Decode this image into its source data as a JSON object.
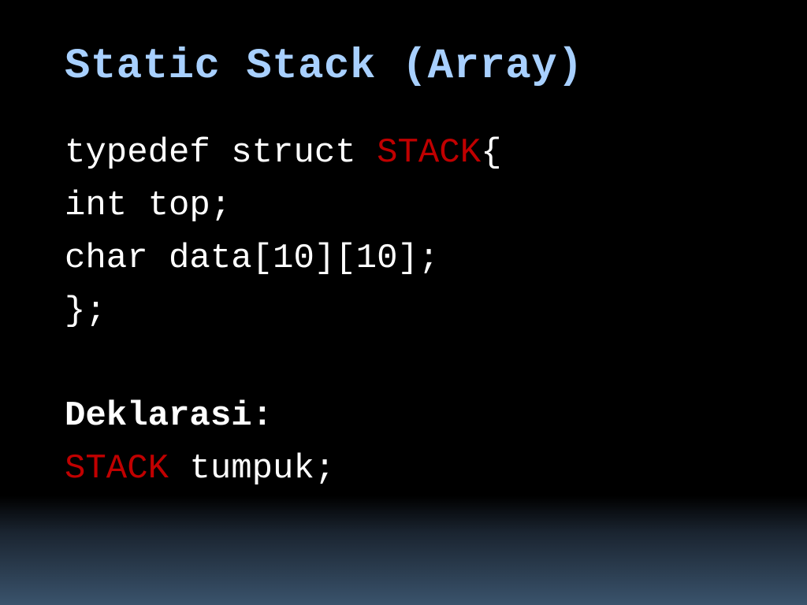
{
  "title": "Static Stack (Array)",
  "code": {
    "line1a": "typedef struct ",
    "line1b": "STACK",
    "line1c": "{",
    "line2": "int top;",
    "line3": "char data[10][10];",
    "line4": "};",
    "blank": " ",
    "decl_label": "Deklarasi:",
    "decl_red": "STACK ",
    "decl_rest": "tumpuk;"
  }
}
